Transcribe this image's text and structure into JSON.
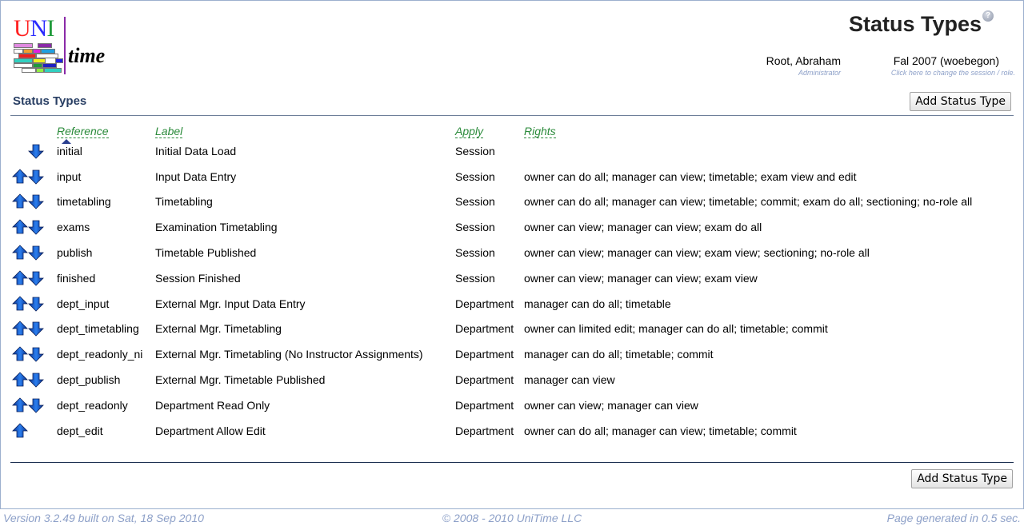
{
  "logo": {
    "uni_u": "U",
    "uni_n": "N",
    "uni_i": "I",
    "time": "time"
  },
  "header": {
    "title": "Status Types",
    "help_icon": "question-circle-icon",
    "user_name": "Root, Abraham",
    "user_role": "Administrator",
    "session_name": "Fal 2007 (woebegon)",
    "session_hint": "Click here to change the session / role."
  },
  "section": {
    "title": "Status Types",
    "add_button_label": "Add Status Type"
  },
  "table": {
    "columns": {
      "reference": "Reference",
      "label": "Label",
      "apply": "Apply",
      "rights": "Rights"
    },
    "sorted_by": "reference",
    "rows": [
      {
        "up": false,
        "down": true,
        "reference": "initial",
        "label": "Initial Data Load",
        "apply": "Session",
        "rights": ""
      },
      {
        "up": true,
        "down": true,
        "reference": "input",
        "label": "Input Data Entry",
        "apply": "Session",
        "rights": "owner can do all; manager can view; timetable; exam view and edit"
      },
      {
        "up": true,
        "down": true,
        "reference": "timetabling",
        "label": "Timetabling",
        "apply": "Session",
        "rights": "owner can do all; manager can view; timetable; commit; exam do all; sectioning; no-role all"
      },
      {
        "up": true,
        "down": true,
        "reference": "exams",
        "label": "Examination Timetabling",
        "apply": "Session",
        "rights": "owner can view; manager can view; exam do all"
      },
      {
        "up": true,
        "down": true,
        "reference": "publish",
        "label": "Timetable Published",
        "apply": "Session",
        "rights": "owner can view; manager can view; exam view; sectioning; no-role all"
      },
      {
        "up": true,
        "down": true,
        "reference": "finished",
        "label": "Session Finished",
        "apply": "Session",
        "rights": "owner can view; manager can view; exam view"
      },
      {
        "up": true,
        "down": true,
        "reference": "dept_input",
        "label": "External Mgr. Input Data Entry",
        "apply": "Department",
        "rights": "manager can do all; timetable"
      },
      {
        "up": true,
        "down": true,
        "reference": "dept_timetabling",
        "label": "External Mgr. Timetabling",
        "apply": "Department",
        "rights": "owner can limited edit; manager can do all; timetable; commit"
      },
      {
        "up": true,
        "down": true,
        "reference": "dept_readonly_ni",
        "label": "External Mgr. Timetabling (No Instructor Assignments)",
        "apply": "Department",
        "rights": "manager can do all; timetable; commit"
      },
      {
        "up": true,
        "down": true,
        "reference": "dept_publish",
        "label": "External Mgr. Timetable Published",
        "apply": "Department",
        "rights": "manager can view"
      },
      {
        "up": true,
        "down": true,
        "reference": "dept_readonly",
        "label": "Department Read Only",
        "apply": "Department",
        "rights": "owner can view; manager can view"
      },
      {
        "up": true,
        "down": false,
        "reference": "dept_edit",
        "label": "Department Allow Edit",
        "apply": "Department",
        "rights": "owner can do all; manager can view; timetable; commit"
      }
    ]
  },
  "footer": {
    "version": "Version 3.2.49 built on Sat, 18 Sep 2010",
    "copyright": "© 2008 - 2010 UniTime LLC",
    "generated": "Page generated in 0.5 sec."
  },
  "colors": {
    "header_link": "#2a8a3a",
    "section_title": "#283e63",
    "muted_text": "#8da0c8",
    "arrow_blue": "#1a5fd0",
    "frame_border": "#9cb0ce"
  }
}
